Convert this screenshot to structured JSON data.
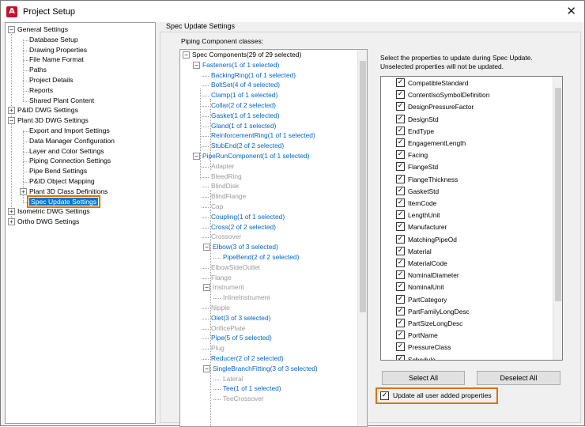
{
  "window": {
    "title": "Project Setup",
    "app_icon": "A",
    "close_glyph": "✕"
  },
  "nav": {
    "items": [
      {
        "label": "General Settings",
        "expander": "−"
      },
      {
        "label": "Database Setup"
      },
      {
        "label": "Drawing Properties"
      },
      {
        "label": "File Name Format"
      },
      {
        "label": "Paths"
      },
      {
        "label": "Project Details"
      },
      {
        "label": "Reports"
      },
      {
        "label": "Shared Plant Content"
      },
      {
        "label": "P&ID DWG Settings",
        "expander": "+"
      },
      {
        "label": "Plant 3D DWG Settings",
        "expander": "−"
      },
      {
        "label": "Export and Import Settings"
      },
      {
        "label": "Data Manager Configuration"
      },
      {
        "label": "Layer and Color Settings"
      },
      {
        "label": "Piping Connection Settings"
      },
      {
        "label": "Pipe Bend Settings"
      },
      {
        "label": "P&ID Object Mapping"
      },
      {
        "label": "Plant 3D Class Definitions",
        "expander": "+"
      },
      {
        "label": "Spec Update Settings",
        "selected": true
      },
      {
        "label": "Isometric DWG Settings",
        "expander": "+"
      },
      {
        "label": "Ortho DWG Settings",
        "expander": "+"
      }
    ]
  },
  "main": {
    "group_title": "Spec Update Settings",
    "classes_label": "Piping Component classes:",
    "hint_line1": "Select the properties to update during Spec Update.",
    "hint_line2": "Unselected properties will not be updated.",
    "select_all": "Select All",
    "deselect_all": "Deselect All",
    "update_all_label": "Update all user added properties",
    "update_all_checked": true
  },
  "component_tree": [
    {
      "label": "Spec Components(29 of 29 selected)",
      "style": "black",
      "expander": "−"
    },
    {
      "label": "Fasteners(1 of 1 selected)",
      "style": "blue",
      "expander": "−"
    },
    {
      "label": "BackingRing(1 of 1 selected)",
      "style": "blue"
    },
    {
      "label": "BoltSet(4 of 4 selected)",
      "style": "blue"
    },
    {
      "label": "Clamp(1 of 1 selected)",
      "style": "blue"
    },
    {
      "label": "Collar(2 of 2 selected)",
      "style": "blue"
    },
    {
      "label": "Gasket(1 of 1 selected)",
      "style": "blue"
    },
    {
      "label": "Gland(1 of 1 selected)",
      "style": "blue"
    },
    {
      "label": "ReinforcementRing(1 of 1 selected)",
      "style": "blue"
    },
    {
      "label": "StubEnd(2 of 2 selected)",
      "style": "blue"
    },
    {
      "label": "PipeRunComponent(1 of 1 selected)",
      "style": "blue",
      "expander": "−"
    },
    {
      "label": "Adapter",
      "style": "gray"
    },
    {
      "label": "BleedRing",
      "style": "gray"
    },
    {
      "label": "BlindDisk",
      "style": "gray"
    },
    {
      "label": "BlindFlange",
      "style": "gray"
    },
    {
      "label": "Cap",
      "style": "gray"
    },
    {
      "label": "Coupling(1 of 1 selected)",
      "style": "blue"
    },
    {
      "label": "Cross(2 of 2 selected)",
      "style": "blue"
    },
    {
      "label": "Crossover",
      "style": "gray"
    },
    {
      "label": "Elbow(3 of 3 selected)",
      "style": "blue",
      "expander": "−"
    },
    {
      "label": "PipeBend(2 of 2 selected)",
      "style": "blue"
    },
    {
      "label": "ElbowSideOutlet",
      "style": "gray"
    },
    {
      "label": "Flange",
      "style": "gray"
    },
    {
      "label": "Instrument",
      "style": "gray",
      "expander": "−"
    },
    {
      "label": "InlineInstrument",
      "style": "gray"
    },
    {
      "label": "Nipple",
      "style": "gray"
    },
    {
      "label": "Olet(3 of 3 selected)",
      "style": "blue"
    },
    {
      "label": "OrificePlate",
      "style": "gray"
    },
    {
      "label": "Pipe(5 of 5 selected)",
      "style": "blue"
    },
    {
      "label": "Plug",
      "style": "gray"
    },
    {
      "label": "Reducer(2 of 2 selected)",
      "style": "blue"
    },
    {
      "label": "SingleBranchFitting(3 of 3 selected)",
      "style": "blue",
      "expander": "−"
    },
    {
      "label": "Lateral",
      "style": "gray"
    },
    {
      "label": "Tee(1 of 1 selected)",
      "style": "blue"
    },
    {
      "label": "TeeCrossover",
      "style": "gray"
    }
  ],
  "properties": [
    {
      "label": "CompatibleStandard",
      "checked": true
    },
    {
      "label": "ContentIsoSymbolDefinition",
      "checked": true
    },
    {
      "label": "DesignPressureFactor",
      "checked": true
    },
    {
      "label": "DesignStd",
      "checked": true
    },
    {
      "label": "EndType",
      "checked": true
    },
    {
      "label": "EngagementLength",
      "checked": true
    },
    {
      "label": "Facing",
      "checked": true
    },
    {
      "label": "FlangeStd",
      "checked": true
    },
    {
      "label": "FlangeThickness",
      "checked": true
    },
    {
      "label": "GasketStd",
      "checked": true
    },
    {
      "label": "ItemCode",
      "checked": true
    },
    {
      "label": "LengthUnit",
      "checked": true
    },
    {
      "label": "Manufacturer",
      "checked": true
    },
    {
      "label": "MatchingPipeOd",
      "checked": true
    },
    {
      "label": "Material",
      "checked": true
    },
    {
      "label": "MaterialCode",
      "checked": true
    },
    {
      "label": "NominalDiameter",
      "checked": true
    },
    {
      "label": "NominalUnit",
      "checked": true
    },
    {
      "label": "PartCategory",
      "checked": true
    },
    {
      "label": "PartFamilyLongDesc",
      "checked": true
    },
    {
      "label": "PartSizeLongDesc",
      "checked": true
    },
    {
      "label": "PortName",
      "checked": true
    },
    {
      "label": "PressureClass",
      "checked": true
    },
    {
      "label": "Schedule",
      "checked": true
    }
  ],
  "colors": {
    "accent": "#0078d7",
    "highlight_border": "#e07000",
    "tree_blue": "#0066cc",
    "tree_gray": "#9a9a9a"
  }
}
